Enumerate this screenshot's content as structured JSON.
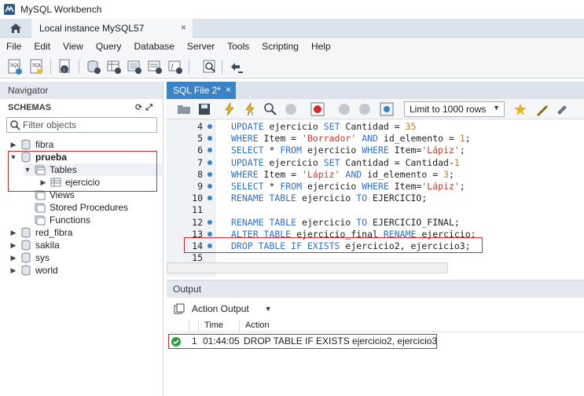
{
  "window": {
    "title": "MySQL Workbench"
  },
  "connection_tab": {
    "label": "Local instance MySQL57",
    "close": "×"
  },
  "menu": [
    "File",
    "Edit",
    "View",
    "Query",
    "Database",
    "Server",
    "Tools",
    "Scripting",
    "Help"
  ],
  "navigator": {
    "title": "Navigator",
    "schemas_label": "SCHEMAS",
    "filter_placeholder": "Filter objects",
    "tree": [
      {
        "label": "fibra"
      },
      {
        "label": "prueba"
      },
      {
        "label": "Tables"
      },
      {
        "label": "ejercicio"
      },
      {
        "label": "Views"
      },
      {
        "label": "Stored Procedures"
      },
      {
        "label": "Functions"
      },
      {
        "label": "red_fibra"
      },
      {
        "label": "sakila"
      },
      {
        "label": "sys"
      },
      {
        "label": "world"
      }
    ]
  },
  "editor_tab": {
    "label": "SQL File 2*",
    "close": "×"
  },
  "editor_toolbar": {
    "limit_label": "Limit to 1000 rows"
  },
  "code_lines": [
    {
      "n": "4",
      "parts": [
        [
          "kw",
          "UPDATE "
        ],
        [
          "id",
          "ejercicio "
        ],
        [
          "kw",
          "SET "
        ],
        [
          "id",
          "Cantidad = "
        ],
        [
          "num",
          "35"
        ]
      ]
    },
    {
      "n": "5",
      "parts": [
        [
          "kw",
          "WHERE "
        ],
        [
          "id",
          "Item = "
        ],
        [
          "str",
          "'Borrador'"
        ],
        [
          "kw",
          " AND "
        ],
        [
          "id",
          "id_elemento = "
        ],
        [
          "num",
          "1"
        ],
        [
          "id",
          ";"
        ]
      ]
    },
    {
      "n": "6",
      "parts": [
        [
          "kw",
          "SELECT "
        ],
        [
          "id",
          "* "
        ],
        [
          "kw",
          "FROM "
        ],
        [
          "id",
          "ejercicio "
        ],
        [
          "kw",
          "WHERE "
        ],
        [
          "id",
          "Item="
        ],
        [
          "str",
          "'Lápiz'"
        ],
        [
          "id",
          ";"
        ]
      ]
    },
    {
      "n": "7",
      "parts": [
        [
          "kw",
          "UPDATE "
        ],
        [
          "id",
          "ejercicio "
        ],
        [
          "kw",
          "SET "
        ],
        [
          "id",
          "Cantidad = Cantidad-"
        ],
        [
          "num",
          "1"
        ]
      ]
    },
    {
      "n": "8",
      "parts": [
        [
          "kw",
          "WHERE "
        ],
        [
          "id",
          "Item = "
        ],
        [
          "str",
          "'Lápiz'"
        ],
        [
          "kw",
          " AND "
        ],
        [
          "id",
          "id_elemento = "
        ],
        [
          "num",
          "3"
        ],
        [
          "id",
          ";"
        ]
      ]
    },
    {
      "n": "9",
      "parts": [
        [
          "kw",
          "SELECT "
        ],
        [
          "id",
          "* "
        ],
        [
          "kw",
          "FROM "
        ],
        [
          "id",
          "ejercicio "
        ],
        [
          "kw",
          "WHERE "
        ],
        [
          "id",
          "Item="
        ],
        [
          "str",
          "'Lápiz'"
        ],
        [
          "id",
          ";"
        ]
      ]
    },
    {
      "n": "10",
      "parts": [
        [
          "kw",
          "RENAME TABLE "
        ],
        [
          "id",
          "ejercicio "
        ],
        [
          "kw",
          "TO "
        ],
        [
          "id",
          "EJERCICIO;"
        ]
      ]
    },
    {
      "n": "11",
      "parts": []
    },
    {
      "n": "12",
      "parts": [
        [
          "kw",
          "RENAME TABLE "
        ],
        [
          "id",
          "ejercicio "
        ],
        [
          "kw",
          "TO "
        ],
        [
          "id",
          "EJERCICIO_FINAL;"
        ]
      ]
    },
    {
      "n": "13",
      "parts": [
        [
          "kw",
          "ALTER TABLE "
        ],
        [
          "id",
          "ejercicio_final "
        ],
        [
          "kw",
          "RENAME "
        ],
        [
          "id",
          "ejercicio;"
        ]
      ]
    },
    {
      "n": "14",
      "parts": [
        [
          "kw",
          "DROP TABLE IF EXISTS "
        ],
        [
          "id",
          "ejercicio2, ejercicio3;"
        ]
      ]
    },
    {
      "n": "15",
      "parts": []
    }
  ],
  "output": {
    "title": "Output",
    "selector_label": "Action Output",
    "columns": {
      "time": "Time",
      "action": "Action"
    },
    "rows": [
      {
        "num": "1",
        "time": "01:44:05",
        "action": "DROP TABLE IF EXISTS ejercicio2, ejercicio3"
      }
    ]
  },
  "colors": {
    "accent": "#3c82c7",
    "highlight_box": "#d9272e",
    "success": "#2e9e3a"
  }
}
